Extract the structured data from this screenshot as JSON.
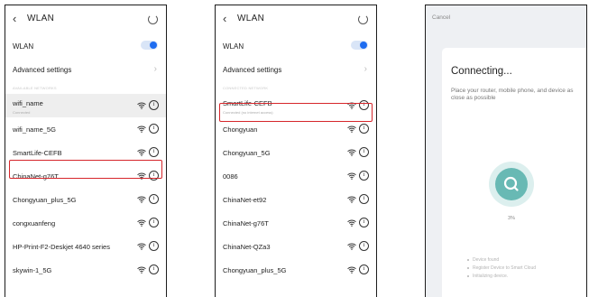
{
  "screen1": {
    "title": "WLAN",
    "wlan_label": "WLAN",
    "advanced_label": "Advanced settings",
    "section_label": "AVAILABLE NETWORKS",
    "networks": [
      {
        "name": "wifi_name",
        "sub": "Connected"
      },
      {
        "name": "wifi_name_5G"
      },
      {
        "name": "SmartLife-CEFB"
      },
      {
        "name": "ChinaNet-g76T"
      },
      {
        "name": "Chongyuan_plus_5G"
      },
      {
        "name": "congxuanfeng"
      },
      {
        "name": "HP-Print-F2-Deskjet 4640 series"
      },
      {
        "name": "skywin-1_5G"
      }
    ]
  },
  "screen2": {
    "title": "WLAN",
    "wlan_label": "WLAN",
    "advanced_label": "Advanced settings",
    "section_label": "CONNECTED NETWORK",
    "networks": [
      {
        "name": "SmartLife-CEFB",
        "sub": "Connected (no internet access)"
      },
      {
        "name": "Chongyuan"
      },
      {
        "name": "Chongyuan_5G"
      },
      {
        "name": "0086"
      },
      {
        "name": "ChinaNet-et92"
      },
      {
        "name": "ChinaNet-g76T"
      },
      {
        "name": "ChinaNet-QZa3"
      },
      {
        "name": "Chongyuan_plus_5G"
      }
    ]
  },
  "screen3": {
    "cancel_label": "Cancel",
    "heading": "Connecting...",
    "description": "Place your router, mobile phone, and device as close as possible",
    "progress_text": "3%",
    "progress_fraction": 0.03,
    "steps": [
      "Device found",
      "Register Device to Smart Cloud",
      "Initializing device."
    ]
  },
  "colors": {
    "highlight": "#d6262b",
    "toggle_accent": "#1e6cf0",
    "progress_teal": "#68b9b4"
  },
  "icons": {
    "back": "chevron-left-icon",
    "refresh": "refresh-spinner-icon",
    "wifi": "wifi-signal-icon",
    "info": "info-icon",
    "search": "search-icon"
  }
}
